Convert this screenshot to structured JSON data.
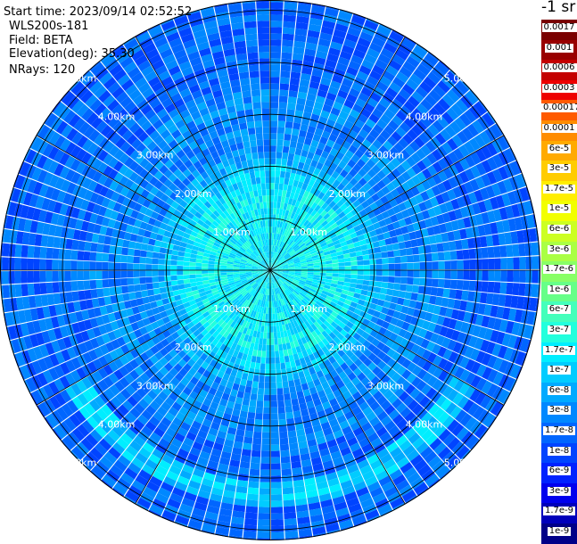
{
  "header": {
    "start_time": "Start time: 2023/09/14 02:52:52",
    "site": "WLS200s-181",
    "field": "Field: BETA",
    "elevation": "Elevation(deg): 35.30",
    "nrays": "NRays: 120"
  },
  "unit_label": "-1 sr",
  "chart_data": {
    "type": "heatmap",
    "projection": "polar-ppi",
    "max_range_km": 5.2,
    "range_rings_km": [
      1,
      2,
      3,
      4,
      5
    ],
    "ring_labels": [
      "1.00km",
      "2.00km",
      "3.00km",
      "4.00km",
      "5.00km"
    ],
    "spoke_angles_deg": [
      0,
      30,
      60,
      90,
      120,
      150,
      180,
      210,
      240,
      270,
      300,
      330
    ],
    "rays": 120,
    "colorbar": {
      "labels": [
        "0.0017",
        "0.001",
        "0.0006",
        "0.0003",
        "0.00017",
        "0.0001",
        "6e-5",
        "3e-5",
        "1.7e-5",
        "1e-5",
        "6e-6",
        "3e-6",
        "1.7e-6",
        "1e-6",
        "6e-7",
        "3e-7",
        "1.7e-7",
        "1e-7",
        "6e-8",
        "3e-8",
        "1.7e-8",
        "1e-8",
        "6e-9",
        "3e-9",
        "1.7e-9",
        "1e-9"
      ],
      "colors": [
        "#7a0000",
        "#990000",
        "#c40000",
        "#ee0000",
        "#ff5a00",
        "#ff8c00",
        "#ffaa00",
        "#ffcc00",
        "#ffee00",
        "#f2ff00",
        "#ccff22",
        "#aaff44",
        "#88ff66",
        "#66ff88",
        "#44ffbb",
        "#22ffdd",
        "#00eeff",
        "#00ccff",
        "#00aaff",
        "#0088ff",
        "#0066ff",
        "#0044ff",
        "#0022ff",
        "#0000ee",
        "#0000bb",
        "#000088"
      ]
    },
    "value_profile": [
      {
        "range_km": 0.0,
        "value": "1.7e-7"
      },
      {
        "range_km": 1.5,
        "value": "1.7e-7"
      },
      {
        "range_km": 2.5,
        "value": "3e-8"
      },
      {
        "range_km": 4.5,
        "value": "1.7e-8"
      }
    ],
    "enhanced_band": {
      "range_km": 4.3,
      "sector_deg": [
        120,
        240
      ],
      "value": "1.7e-7"
    }
  }
}
